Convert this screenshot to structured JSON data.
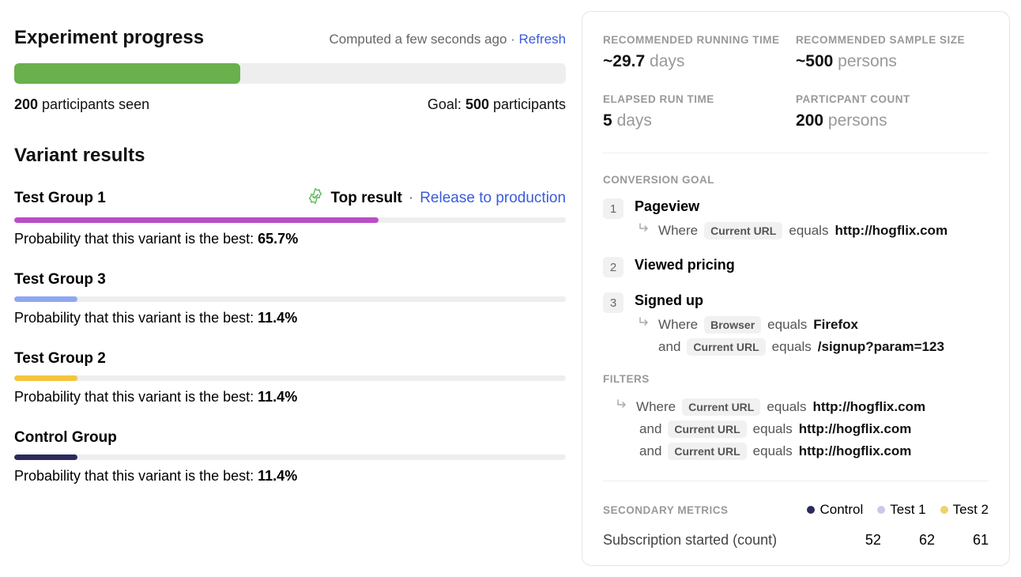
{
  "progress": {
    "title": "Experiment progress",
    "computed": "Computed a few seconds ago",
    "sep": " · ",
    "refresh": "Refresh",
    "fill_pct": 41,
    "fill_color": "#6ab04c",
    "seen_prefix": "200",
    "seen_suffix": " participants seen",
    "goal_prefix": "Goal: ",
    "goal_strong": "500 ",
    "goal_suffix": "participants"
  },
  "variants": {
    "title": "Variant results",
    "prob_label": "Probability that this variant is the best: ",
    "items": [
      {
        "name": "Test Group 1",
        "top": true,
        "top_label": "Top result",
        "top_sep": " · ",
        "release": "Release to production",
        "prob": "65.7%",
        "fill": 66,
        "color": "#b94dc7"
      },
      {
        "name": "Test Group 3",
        "prob": "11.4%",
        "fill": 11.4,
        "color": "#8ea7f2"
      },
      {
        "name": "Test Group 2",
        "prob": "11.4%",
        "fill": 11.4,
        "color": "#f5c53b"
      },
      {
        "name": "Control Group",
        "prob": "11.4%",
        "fill": 11.4,
        "color": "#2b2b5c"
      }
    ]
  },
  "stats": {
    "rec_time_label": "RECOMMENDED RUNNING TIME",
    "rec_time_value": "~29.7",
    "rec_time_unit": " days",
    "rec_sample_label": "RECOMMENDED SAMPLE SIZE",
    "rec_sample_value": "~500",
    "rec_sample_unit": " persons",
    "elapsed_label": "ELAPSED RUN TIME",
    "elapsed_value": "5",
    "elapsed_unit": " days",
    "count_label": "PARTICPANT COUNT",
    "count_value": "200",
    "count_unit": " persons"
  },
  "goal": {
    "heading": "CONVERSION GOAL",
    "where": "Where",
    "and": "and",
    "equals": "equals",
    "steps": [
      {
        "num": "1",
        "title": "Pageview",
        "conds": [
          {
            "chip": "Current URL",
            "value": "http://hogflix.com"
          }
        ]
      },
      {
        "num": "2",
        "title": "Viewed pricing",
        "conds": []
      },
      {
        "num": "3",
        "title": "Signed up",
        "conds": [
          {
            "chip": "Browser",
            "value": "Firefox"
          },
          {
            "chip": "Current URL",
            "value": "/signup?param=123"
          }
        ]
      }
    ]
  },
  "filters": {
    "heading": "FILTERS",
    "where": "Where",
    "and": "and",
    "equals": "equals",
    "items": [
      {
        "chip": "Current URL",
        "value": "http://hogflix.com"
      },
      {
        "chip": "Current URL",
        "value": "http://hogflix.com"
      },
      {
        "chip": "Current URL",
        "value": "http://hogflix.com"
      }
    ]
  },
  "secondary": {
    "heading": "SECONDARY METRICS",
    "legend": [
      {
        "label": "Control",
        "color": "#2b2b5c"
      },
      {
        "label": "Test 1",
        "color": "#cfc6e4"
      },
      {
        "label": "Test 2",
        "color": "#eed26a"
      }
    ],
    "metric_name": "Subscription started (count)",
    "vals": [
      "52",
      "62",
      "61"
    ]
  }
}
